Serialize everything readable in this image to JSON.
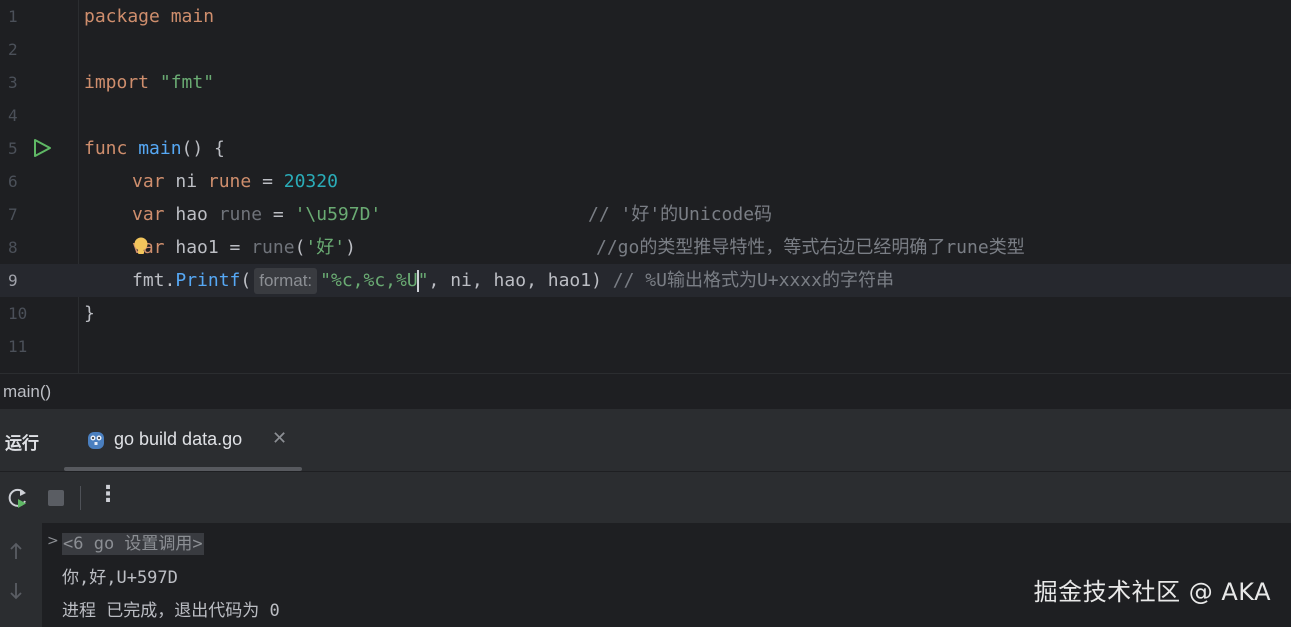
{
  "editor": {
    "lines": [
      {
        "num": "1",
        "code": "package main"
      },
      {
        "num": "2"
      },
      {
        "num": "3",
        "kw": "import ",
        "str": "\"fmt\""
      },
      {
        "num": "4"
      },
      {
        "num": "5",
        "kw": "func ",
        "fn": "main",
        "rest": "() {"
      },
      {
        "num": "6",
        "kw1": "var",
        "mid": " ni ",
        "kw2": "rune",
        "eq": " = ",
        "n": "20320"
      },
      {
        "num": "7",
        "kw1": "var",
        "mid": " hao ",
        "typ": "rune",
        "eq": " = ",
        "s": "'\\u597D'",
        "comment": "// '好'的Unicode码"
      },
      {
        "num": "8",
        "kw1": "var",
        "mid": " hao1 = ",
        "typ": "rune",
        "p1": "(",
        "s": "'好'",
        "p2": ")",
        "comment": "//go的类型推导特性，等式右边已经明确了rune类型"
      },
      {
        "num": "9",
        "call": "fmt.",
        "fn": "Printf",
        "p1": "(",
        "hint": "format:",
        "s1": "\"%c,%c,%U",
        "s2": "\"",
        "args": ", ni, hao, hao1) ",
        "comment": "// %U输出格式为U+xxxx的字符串"
      },
      {
        "num": "10",
        "code": "}"
      },
      {
        "num": "11"
      }
    ]
  },
  "breadcrumb": "main()",
  "run_panel": {
    "title": "运行",
    "tab_label": "go build data.go",
    "console": {
      "command": "<6 go 设置调用>",
      "output": "你,好,U+597D",
      "exit": "进程 已完成，退出代码为 0"
    }
  },
  "watermark": "掘金技术社区 @ AKA",
  "colors": {
    "background": "#1e1f22",
    "keyword": "#cf8e6d",
    "function": "#56a8f5",
    "number": "#2aacb8",
    "string": "#6aab73",
    "comment": "#7a7e85",
    "run_icon": "#5fb865",
    "bulb": "#f2c55c"
  }
}
